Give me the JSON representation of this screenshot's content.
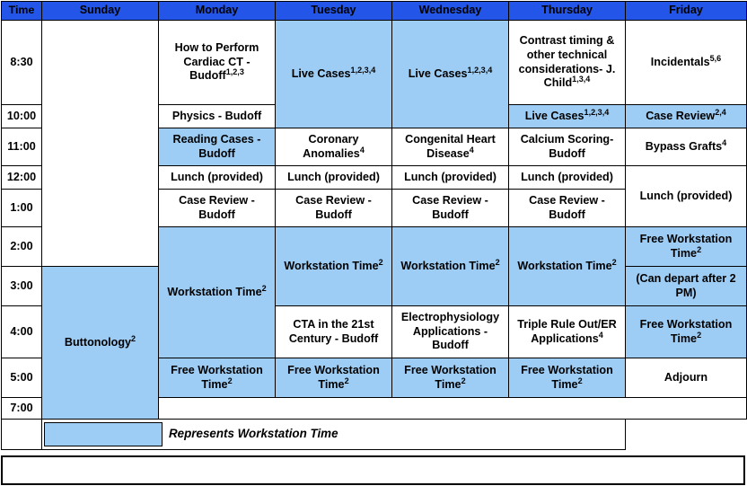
{
  "header": {
    "time_label": "Time",
    "days": [
      "Sunday",
      "Monday",
      "Tuesday",
      "Wednesday",
      "Thursday",
      "Friday"
    ]
  },
  "times": [
    "8:30",
    "10:00",
    "11:00",
    "12:00",
    "1:00",
    "2:00",
    "3:00",
    "4:00",
    "5:00",
    "7:00"
  ],
  "cells": {
    "mon_830": {
      "text": "How to Perform Cardiac CT - Budoff",
      "sup": "1,2,3"
    },
    "tue_830": {
      "text": "Live Cases",
      "sup": "1,2,3,4"
    },
    "wed_830": {
      "text": "Live Cases",
      "sup": "1,2,3,4"
    },
    "thu_830": {
      "text": "Contrast timing & other technical considerations- J. Child",
      "sup": "1,3,4"
    },
    "fri_830": {
      "text": "Incidentals",
      "sup": "5,6"
    },
    "mon_1000": {
      "text": "Physics - Budoff",
      "sup": ""
    },
    "thu_1000": {
      "text": "Live Cases",
      "sup": "1,2,3,4"
    },
    "fri_1000": {
      "text": "Case Review",
      "sup": "2,4"
    },
    "mon_1100": {
      "text": "Reading Cases - Budoff",
      "sup": ""
    },
    "tue_1100": {
      "text": "Coronary Anomalies",
      "sup": "4"
    },
    "wed_1100": {
      "text": "Congenital Heart Disease",
      "sup": "4"
    },
    "thu_1100": {
      "text": "Calcium Scoring- Budoff",
      "sup": ""
    },
    "fri_1100": {
      "text": "Bypass Grafts",
      "sup": "4"
    },
    "mon_1200": {
      "text": "Lunch (provided)",
      "sup": ""
    },
    "tue_1200": {
      "text": "Lunch (provided)",
      "sup": ""
    },
    "wed_1200": {
      "text": "Lunch (provided)",
      "sup": ""
    },
    "thu_1200": {
      "text": "Lunch (provided)",
      "sup": ""
    },
    "fri_1200": {
      "text": "Lunch (provided)",
      "sup": ""
    },
    "mon_100": {
      "text": "Case Review - Budoff",
      "sup": ""
    },
    "tue_100": {
      "text": "Case Review - Budoff",
      "sup": ""
    },
    "wed_100": {
      "text": "Case Review - Budoff",
      "sup": ""
    },
    "thu_100": {
      "text": "Case Review - Budoff",
      "sup": ""
    },
    "fri_200": {
      "text": "Free Workstation Time",
      "sup": "2"
    },
    "fri_300": {
      "text": "(Can depart after 2 PM)",
      "sup": ""
    },
    "sun_300": {
      "text": "Buttonology",
      "sup": "2"
    },
    "mon_200": {
      "text": "Workstation Time",
      "sup": "2"
    },
    "tue_200": {
      "text": "Workstation Time",
      "sup": "2"
    },
    "wed_200": {
      "text": "Workstation Time",
      "sup": "2"
    },
    "thu_200": {
      "text": "Workstation Time",
      "sup": "2"
    },
    "tue_400": {
      "text": "CTA in the 21st Century - Budoff",
      "sup": ""
    },
    "wed_400": {
      "text": "Electrophysiology Applications - Budoff",
      "sup": ""
    },
    "thu_400": {
      "text": "Triple Rule Out/ER Applications",
      "sup": "4"
    },
    "fri_400": {
      "text": "Free Workstation Time",
      "sup": "2"
    },
    "mon_500": {
      "text": "Free Workstation Time",
      "sup": "2"
    },
    "tue_500": {
      "text": "Free Workstation Time",
      "sup": "2"
    },
    "wed_500": {
      "text": "Free Workstation Time",
      "sup": "2"
    },
    "thu_500": {
      "text": "Free Workstation Time",
      "sup": "2"
    },
    "fri_500": {
      "text": "Adjourn",
      "sup": ""
    }
  },
  "legend": {
    "text": "Represents Workstation Time"
  },
  "colors": {
    "header_blue": "#2255E8",
    "workstation_blue": "#9DCDF5",
    "border": "#000000",
    "background": "#FFFFFF"
  }
}
